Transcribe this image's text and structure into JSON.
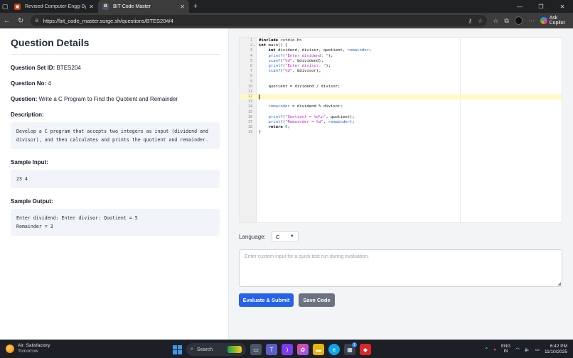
{
  "browser": {
    "tabs": [
      {
        "title": "Revised-Computer-Engg-Syllabus",
        "active": false
      },
      {
        "title": "BIT Code Master",
        "active": true
      }
    ],
    "url": "https://bit_code_master.surge.sh/questions/BTES204/4",
    "copilot_label": "Ask Copilot"
  },
  "question": {
    "heading": "Question Details",
    "set_id_label": "Question Set ID:",
    "set_id": "BTES204",
    "no_label": "Question No:",
    "no": "4",
    "question_label": "Question:",
    "question_text": "Write a C Program to Find the Quotient and Remainder",
    "description_label": "Description:",
    "description": "Develop a C program that accepts two integers as input (dividend and divisor), and then calculates and prints the quotient and remainder.",
    "sample_input_label": "Sample Input:",
    "sample_input": "23 4",
    "sample_output_label": "Sample Output:",
    "sample_output": "Enter dividend: Enter divisor: Quotient = 5\nRemainder = 3"
  },
  "editor": {
    "active_line": 12,
    "lines": [
      "#include <stdio.h>",
      "int main() {",
      "    int dividend, divisor, quotient, remainder;",
      "    printf(\"Enter dividend: \");",
      "    scanf(\"%d\", &dividend);",
      "    printf(\"Enter divisor: \");",
      "    scanf(\"%d\", &divisor);",
      "",
      "",
      "    quotient = dividend / divisor;",
      "",
      "",
      "",
      "    remainder = dividend % divisor;",
      "",
      "    printf(\"Quotient = %d\\n\", quotient);",
      "    printf(\"Remainder = %d\", remainder);",
      "    return 0;",
      "}",
      ""
    ],
    "line_numbers": [
      "1",
      "2",
      "3",
      "4",
      "5",
      "6",
      "7",
      "8",
      "9",
      "10",
      "11",
      "12",
      "13",
      "14",
      "15",
      "16",
      "17",
      "18",
      "19"
    ]
  },
  "controls": {
    "language_label": "Language:",
    "language_value": "C",
    "custom_input_placeholder": "Enter custom input for a quick test run during evaluation.",
    "evaluate_label": "Evaluate & Submit",
    "save_label": "Save Code"
  },
  "taskbar": {
    "weather_title": "Air: Satisfactory",
    "weather_sub": "Tomorrow",
    "search_label": "Search",
    "lang_top": "ENG",
    "lang_bottom": "IN",
    "time": "6:42 PM",
    "date": "11/10/2025",
    "store_badge": "1"
  }
}
